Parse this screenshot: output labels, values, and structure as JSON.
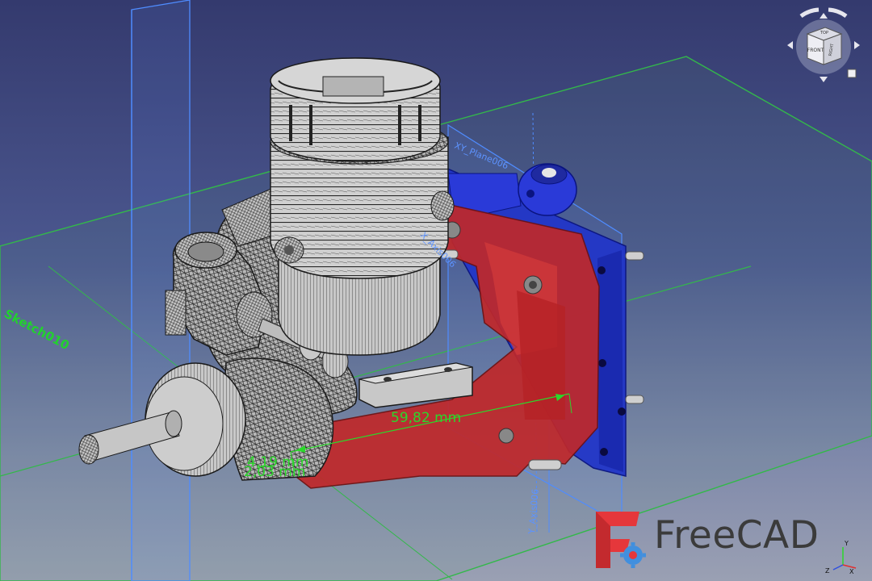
{
  "app": {
    "name": "FreeCAD"
  },
  "brand": {
    "text": "FreeCAD",
    "colors": {
      "red": "#e5373b",
      "blue": "#418fde",
      "text": "#3b3b3b"
    }
  },
  "scene": {
    "planes": {
      "xy_plane_label": "XY_Plane006",
      "xz_plane_label": "X_Axis006",
      "y_axis_label": "Y_Axis006"
    },
    "sketch_label": "Sketch010",
    "dimensions": [
      {
        "label": "59,82 mm"
      },
      {
        "label": "4,19 mm"
      },
      {
        "label": "2,03 mm"
      }
    ],
    "colors": {
      "mount_red": "#c0282a",
      "backplate_blue": "#2236c8",
      "dimension_green": "#2bd82b",
      "plane_blue": "#4f8cff",
      "grid_green": "#33b84a"
    }
  },
  "navcube": {
    "faces": {
      "front": "FRONT",
      "top": "TOP",
      "right": "RIGHT"
    },
    "icons": [
      "rotate-left-icon",
      "rotate-right-icon",
      "arrow-up-icon",
      "arrow-down-icon",
      "arrow-left-icon",
      "arrow-right-icon",
      "view-menu-icon"
    ]
  },
  "axis_triad": {
    "x": "X",
    "y": "Y",
    "z": "Z"
  }
}
